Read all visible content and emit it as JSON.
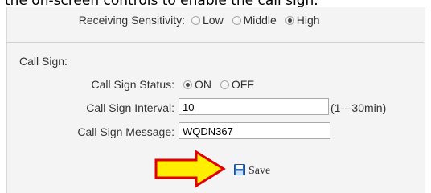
{
  "header_fragment": "the on-screen controls to enable the call sign.",
  "receiving_sensitivity": {
    "label": "Receiving Sensitivity:",
    "options": [
      {
        "label": "Low",
        "checked": false
      },
      {
        "label": "Middle",
        "checked": false
      },
      {
        "label": "High",
        "checked": true
      }
    ]
  },
  "call_sign": {
    "section_title": "Call Sign:",
    "status": {
      "label": "Call Sign Status:",
      "options": [
        {
          "label": "ON",
          "checked": true
        },
        {
          "label": "OFF",
          "checked": false
        }
      ]
    },
    "interval": {
      "label": "Call Sign Interval:",
      "value": "10",
      "hint": "(1---30min)"
    },
    "message": {
      "label": "Call Sign Message:",
      "value": "WQDN367"
    }
  },
  "save_label": "Save",
  "colors": {
    "arrow_fill": "#ffee00",
    "arrow_stroke": "#e00000",
    "save_icon": "#2f6fc2"
  }
}
